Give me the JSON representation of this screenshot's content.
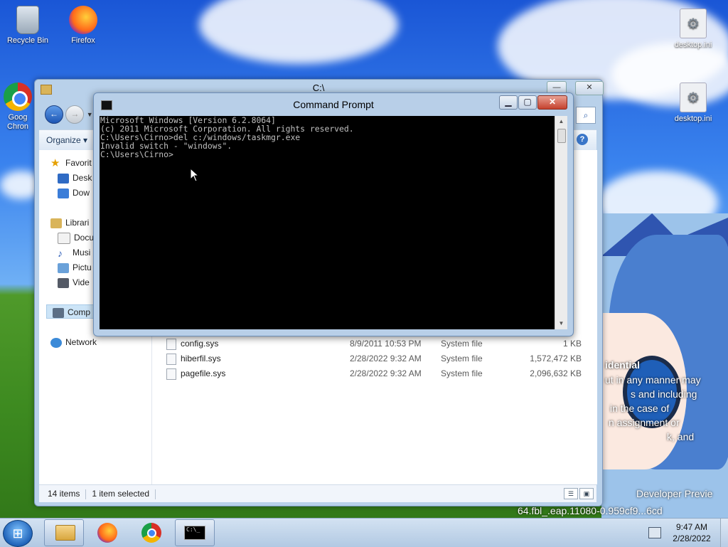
{
  "desktop": {
    "icons": [
      {
        "label": "Recycle Bin",
        "icon": "recycle-bin-icon"
      },
      {
        "label": "Firefox",
        "icon": "firefox-icon"
      },
      {
        "label": "Goog\nChron",
        "icon": "chrome-icon"
      },
      {
        "label": "desktop.ini",
        "icon": "settings-file-icon"
      },
      {
        "label": "desktop.ini",
        "icon": "settings-file-icon"
      }
    ],
    "wallpaper_text": {
      "line1": "idential",
      "line2": "ut in any manner may",
      "line3": "s and including",
      "line4": "in the case of",
      "line5": "n assignment or",
      "line6": "k, and",
      "line7": "Developer Previe",
      "line8": "64.fbl_.eap.11080-0.959cf9...6cd"
    }
  },
  "explorer": {
    "title": "C:\\",
    "organize_label": "Organize ▾",
    "nav": {
      "favorites": "Favorit",
      "desktop": "Desk",
      "downloads": "Dow",
      "libraries": "Librari",
      "documents": "Docu",
      "music": "Musi",
      "pictures": "Pictu",
      "videos": "Vide",
      "computer": "Comp",
      "network": "Network"
    },
    "files": [
      {
        "name": "config.sys",
        "date": "8/9/2011 10:53 PM",
        "type": "System file",
        "size": "1 KB"
      },
      {
        "name": "hiberfil.sys",
        "date": "2/28/2022 9:32 AM",
        "type": "System file",
        "size": "1,572,472 KB"
      },
      {
        "name": "pagefile.sys",
        "date": "2/28/2022 9:32 AM",
        "type": "System file",
        "size": "2,096,632 KB"
      }
    ],
    "status": {
      "item_count": "14 items",
      "selected": "1 item selected"
    }
  },
  "cmd": {
    "title": "Command Prompt",
    "lines": [
      "Microsoft Windows [Version 6.2.8064]",
      "(c) 2011 Microsoft Corporation. All rights reserved.",
      "",
      "C:\\Users\\Cirno>del c:/windows/taskmgr.exe",
      "Invalid switch - \"windows\".",
      "",
      "C:\\Users\\Cirno>"
    ]
  },
  "taskbar": {
    "time": "9:47 AM",
    "date": "2/28/2022"
  }
}
